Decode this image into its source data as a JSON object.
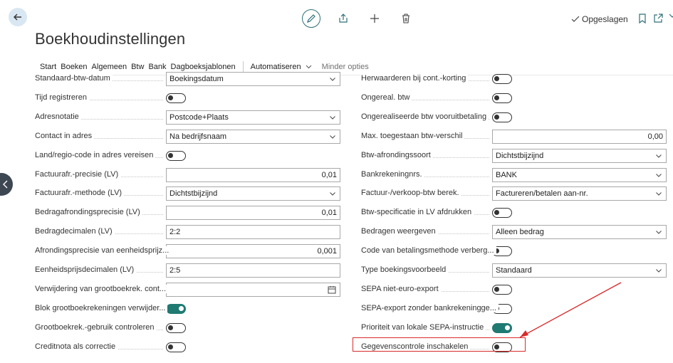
{
  "header": {
    "saved_label": "Opgeslagen",
    "page_title": "Boekhoudinstellingen"
  },
  "actions": {
    "items": [
      "Start",
      "Boeken",
      "Algemeen",
      "Btw",
      "Bank",
      "Dagboeksjablonen"
    ],
    "automate": "Automatiseren",
    "less": "Minder opties"
  },
  "left_fields": [
    {
      "label": "Standaard-btw-datum",
      "type": "select",
      "value": "Boekingsdatum"
    },
    {
      "label": "Tijd registreren",
      "type": "toggle",
      "on": false
    },
    {
      "label": "Adresnotatie",
      "type": "select",
      "value": "Postcode+Plaats"
    },
    {
      "label": "Contact in adres",
      "type": "select",
      "value": "Na bedrijfsnaam"
    },
    {
      "label": "Land/regio-code in adres vereisen",
      "type": "toggle",
      "on": false
    },
    {
      "label": "Factuurafr.-precisie (LV)",
      "type": "number",
      "value": "0,01"
    },
    {
      "label": "Factuurafr.-methode (LV)",
      "type": "select",
      "value": "Dichtstbijzijnd"
    },
    {
      "label": "Bedragafrondingsprecisie (LV)",
      "type": "number",
      "value": "0,01"
    },
    {
      "label": "Bedragdecimalen (LV)",
      "type": "text",
      "value": "2:2"
    },
    {
      "label": "Afrondingsprecisie van eenheidsprijz...",
      "type": "number",
      "value": "0,001"
    },
    {
      "label": "Eenheidsprijsdecimalen (LV)",
      "type": "text",
      "value": "2:5"
    },
    {
      "label": "Verwijdering van grootboekrek. cont...",
      "type": "date",
      "value": ""
    },
    {
      "label": "Blok grootboekrekeningen verwijder...",
      "type": "toggle",
      "on": true
    },
    {
      "label": "Grootboekrek.-gebruik controleren",
      "type": "toggle",
      "on": false
    },
    {
      "label": "Creditnota als correctie",
      "type": "toggle",
      "on": false
    }
  ],
  "right_fields": [
    {
      "label": "Herwaarderen bij cont.-korting",
      "type": "toggle",
      "on": false
    },
    {
      "label": "Ongereal. btw",
      "type": "toggle",
      "on": false
    },
    {
      "label": "Ongerealiseerde btw vooruitbetaling",
      "type": "toggle",
      "on": false
    },
    {
      "label": "Max. toegestaan btw-verschil",
      "type": "number",
      "value": "0,00"
    },
    {
      "label": "Btw-afrondingssoort",
      "type": "select",
      "value": "Dichtstbijzijnd"
    },
    {
      "label": "Bankrekeningnrs.",
      "type": "select",
      "value": "BANK"
    },
    {
      "label": "Factuur-/verkoop-btw berek.",
      "type": "select",
      "value": "Factureren/betalen aan-nr."
    },
    {
      "label": "Btw-specificatie in LV afdrukken",
      "type": "toggle",
      "on": false
    },
    {
      "label": "Bedragen weergeven",
      "type": "select",
      "value": "Alleen bedrag"
    },
    {
      "label": "Code van betalingsmethode verberg...",
      "type": "toggle",
      "on": false
    },
    {
      "label": "Type boekingsvoorbeeld",
      "type": "select",
      "value": "Standaard"
    },
    {
      "label": "SEPA niet-euro-export",
      "type": "toggle",
      "on": false
    },
    {
      "label": "SEPA-export zonder bankrekeningge...",
      "type": "toggle",
      "on": false
    },
    {
      "label": "Prioriteit van lokale SEPA-instructie",
      "type": "toggle",
      "on": true
    },
    {
      "label": "Gegevenscontrole inschakelen",
      "type": "toggle",
      "on": false
    }
  ]
}
